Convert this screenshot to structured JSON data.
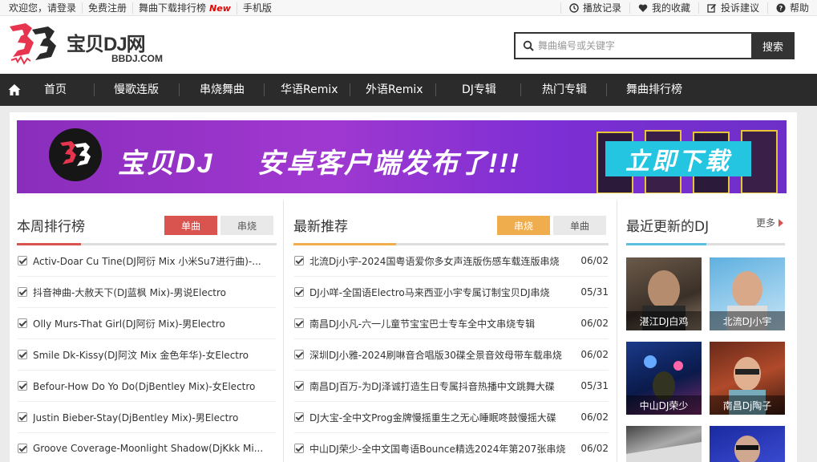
{
  "topbar": {
    "welcome": "欢迎您，请登录",
    "register": "免费注册",
    "chart_download": "舞曲下载排行榜",
    "new_badge": "New",
    "mobile": "手机版",
    "play_history": "播放记录",
    "favorites": "我的收藏",
    "feedback": "投诉建议",
    "help": "帮助"
  },
  "logo": {
    "zh": "宝贝DJ网",
    "en": "BBDJ.COM"
  },
  "search": {
    "placeholder": "舞曲编号或关键字",
    "button": "搜索"
  },
  "nav": {
    "items": [
      "首页",
      "慢歌连版",
      "串烧舞曲",
      "华语Remix",
      "外语Remix",
      "DJ专辑",
      "热门专辑",
      "舞曲排行榜"
    ]
  },
  "banner": {
    "brand": "宝贝DJ",
    "headline": "安卓客户端发布了!!!",
    "download": "立即下载"
  },
  "weekly": {
    "title": "本周排行榜",
    "tab_active": "单曲",
    "tab_inactive": "串烧",
    "items": [
      "Activ-Doar Cu Tine(DJ阿衍 Mix 小米Su7进行曲)-...",
      "抖音神曲-大赦天下(DJ蓝枫 Mix)-男说Electro",
      "Olly Murs-That Girl(DJ阿衍 Mix)-男Electro",
      "Smile Dk-Kissy(DJ阿汶 Mix 金色年华)-女Electro",
      "Befour-How Do Yo Do(DjBentley Mix)-女Electro",
      "Justin Bieber-Stay(DjBentley Mix)-男Electro",
      "Groove Coverage-Moonlight Shadow(DjKkk Mi..."
    ]
  },
  "latest": {
    "title": "最新推荐",
    "tab_active": "串烧",
    "tab_inactive": "单曲",
    "items": [
      {
        "text": "北流Dj小宇-2024国粤语爱你多女声连版伤感车载连版串烧",
        "date": "06/02"
      },
      {
        "text": "DJ小咩-全国语Electro马来西亚小宇专属订制宝贝DJ串烧",
        "date": "05/31"
      },
      {
        "text": "南昌DJ小凡-六一儿童节宝宝巴士专车全中文串烧专辑",
        "date": "06/02"
      },
      {
        "text": "深圳DJ小雅-2024刷啉音合唱版30碟全景音效母带车载串烧",
        "date": "06/02"
      },
      {
        "text": "南昌DJ百万-为DJ泽诚打造生日专属抖音热播中文跳舞大碟",
        "date": "05/31"
      },
      {
        "text": "DJ大宝-全中文Prog金牌慢摇重生之无心睡眠咚鼓慢摇大碟",
        "date": "06/02"
      },
      {
        "text": "中山DJ荣少-全中文国粤语Bounce精选2024年第207张串烧",
        "date": "06/02"
      }
    ]
  },
  "recent_djs": {
    "title": "最近更新的DJ",
    "more": "更多",
    "items": [
      "湛江DJ白鸡",
      "北流DJ小宇",
      "中山DJ荣少",
      "南昌Dj陶子",
      "",
      ""
    ]
  },
  "colors": {
    "red": "#d9534f",
    "orange": "#f0ad4e",
    "blue": "#5bc0de",
    "nav_bg": "#2b2b2b"
  }
}
